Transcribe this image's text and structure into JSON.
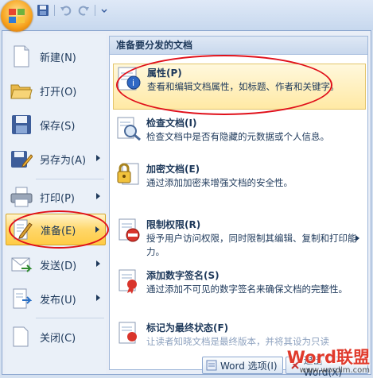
{
  "quick_access": {
    "save_icon": "save-icon",
    "undo_icon": "undo-icon",
    "redo_icon": "redo-icon",
    "customize_icon": "chevron-down-icon"
  },
  "left_menu": [
    {
      "label": "新建(N)",
      "icon": "new-document-icon",
      "has_arrow": false
    },
    {
      "label": "打开(O)",
      "icon": "open-folder-icon",
      "has_arrow": false
    },
    {
      "label": "保存(S)",
      "icon": "save-icon",
      "has_arrow": false
    },
    {
      "label": "另存为(A)",
      "icon": "save-as-icon",
      "has_arrow": true
    },
    {
      "label": "打印(P)",
      "icon": "printer-icon",
      "has_arrow": true
    },
    {
      "label": "准备(E)",
      "icon": "prepare-icon",
      "has_arrow": true,
      "active": true
    },
    {
      "label": "发送(D)",
      "icon": "send-icon",
      "has_arrow": true
    },
    {
      "label": "发布(U)",
      "icon": "publish-icon",
      "has_arrow": true
    },
    {
      "label": "关闭(C)",
      "icon": "close-document-icon",
      "has_arrow": false
    }
  ],
  "right_panel": {
    "header": "准备要分发的文档",
    "entries": [
      {
        "title": "属性(P)",
        "desc": "查看和编辑文档属性，如标题、作者和关键字。",
        "icon": "properties-icon",
        "highlighted": true
      },
      {
        "title": "检查文档(I)",
        "desc": "检查文档中是否有隐藏的元数据或个人信息。",
        "icon": "inspect-document-icon"
      },
      {
        "title": "加密文档(E)",
        "desc": "通过添加加密来增强文档的安全性。",
        "icon": "encrypt-document-icon"
      },
      {
        "title": "限制权限(R)",
        "desc": "授予用户访问权限，同时限制其编辑、复制和打印能力。",
        "icon": "restrict-permission-icon",
        "has_arrow": true
      },
      {
        "title": "添加数字签名(S)",
        "desc": "通过添加不可见的数字签名来确保文档的完整性。",
        "icon": "digital-signature-icon"
      },
      {
        "title": "标记为最终状态(F)",
        "desc": "让读者知晓文档是最终版本，并将其设为只读",
        "icon": "mark-final-icon"
      }
    ]
  },
  "bottom": {
    "word_options": "Word 选项(I)",
    "exit": "退出 Word(X)"
  },
  "watermark": {
    "brand": "Word联盟",
    "url": "www.wordlm.com"
  },
  "colors": {
    "accent": "#ffcb45",
    "annotation": "#e0101a",
    "text": "#1e395b"
  }
}
